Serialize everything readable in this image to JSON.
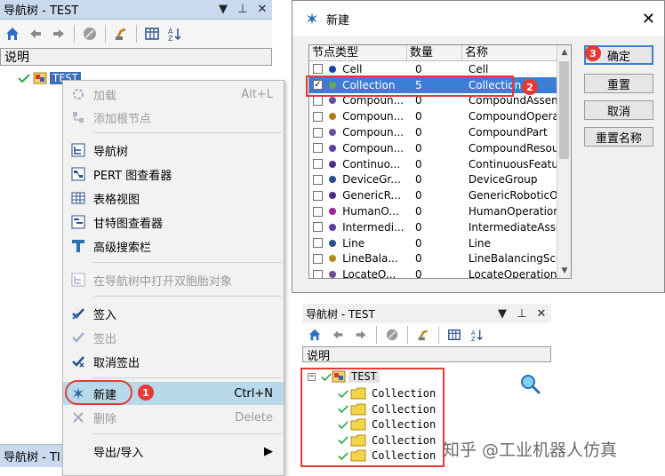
{
  "nav_panel": {
    "title": "导航树 - TEST",
    "column_header": "说明",
    "root_label": "TEST",
    "bottom_tab": "导航树 - TI"
  },
  "context_menu": {
    "items": [
      {
        "label": "加载",
        "shortcut": "Alt+L",
        "disabled": true
      },
      {
        "label": "添加根节点",
        "shortcut": "",
        "disabled": true
      },
      {
        "label": "导航树",
        "shortcut": "",
        "disabled": false
      },
      {
        "label": "PERT 图查看器",
        "shortcut": "",
        "disabled": false
      },
      {
        "label": "表格视图",
        "shortcut": "",
        "disabled": false
      },
      {
        "label": "甘特图查看器",
        "shortcut": "",
        "disabled": false
      },
      {
        "label": "高级搜索栏",
        "shortcut": "",
        "disabled": false
      },
      {
        "label": "在导航树中打开双胞胎对象",
        "shortcut": "",
        "disabled": true
      },
      {
        "label": "签入",
        "shortcut": "",
        "disabled": false
      },
      {
        "label": "签出",
        "shortcut": "",
        "disabled": true
      },
      {
        "label": "取消签出",
        "shortcut": "",
        "disabled": false
      },
      {
        "label": "新建",
        "shortcut": "Ctrl+N",
        "disabled": false
      },
      {
        "label": "删除",
        "shortcut": "Delete",
        "disabled": true
      },
      {
        "label": "导出/导入",
        "shortcut": "",
        "disabled": false
      }
    ]
  },
  "new_dialog": {
    "title": "新建",
    "columns": [
      "节点类型",
      "数量",
      "名称"
    ],
    "rows": [
      {
        "type": "Cell",
        "qty": "0",
        "name": "Cell",
        "checked": false
      },
      {
        "type": "Collection",
        "qty": "5",
        "name": "Collection",
        "checked": true
      },
      {
        "type": "Compoun...",
        "qty": "0",
        "name": "CompoundAssembly",
        "checked": false
      },
      {
        "type": "Compoun...",
        "qty": "0",
        "name": "CompoundOperati...",
        "checked": false
      },
      {
        "type": "Compoun...",
        "qty": "0",
        "name": "CompoundPart",
        "checked": false
      },
      {
        "type": "Compoun...",
        "qty": "0",
        "name": "CompoundResour...",
        "checked": false
      },
      {
        "type": "Continuo...",
        "qty": "0",
        "name": "ContinuousFeatur...",
        "checked": false
      },
      {
        "type": "DeviceGr...",
        "qty": "0",
        "name": "DeviceGroup",
        "checked": false
      },
      {
        "type": "GenericR...",
        "qty": "0",
        "name": "GenericRoboticO...",
        "checked": false
      },
      {
        "type": "HumanO...",
        "qty": "0",
        "name": "HumanOperation",
        "checked": false
      },
      {
        "type": "Intermedi...",
        "qty": "0",
        "name": "IntermediateAsse...",
        "checked": false
      },
      {
        "type": "Line",
        "qty": "0",
        "name": "Line",
        "checked": false
      },
      {
        "type": "LineBala...",
        "qty": "0",
        "name": "LineBalancingSco...",
        "checked": false
      },
      {
        "type": "LocateO...",
        "qty": "0",
        "name": "LocateOperation",
        "checked": false
      }
    ],
    "buttons": {
      "ok": "确定",
      "reset": "重置",
      "cancel": "取消",
      "rename": "重置名称"
    }
  },
  "nav_panel_2": {
    "title": "导航树 - TEST",
    "column_header": "说明",
    "root_label": "TEST",
    "children": [
      "Collection",
      "Collection",
      "Collection",
      "Collection",
      "Collection"
    ]
  },
  "badges": {
    "one": "1",
    "two": "2",
    "three": "3"
  },
  "watermark": "知乎 @工业机器人仿真",
  "colors": {
    "selection": "#3a7fd5",
    "highlight": "#b7d9ea",
    "annotation": "#e53935",
    "panel_title": "#c9d9ee"
  }
}
